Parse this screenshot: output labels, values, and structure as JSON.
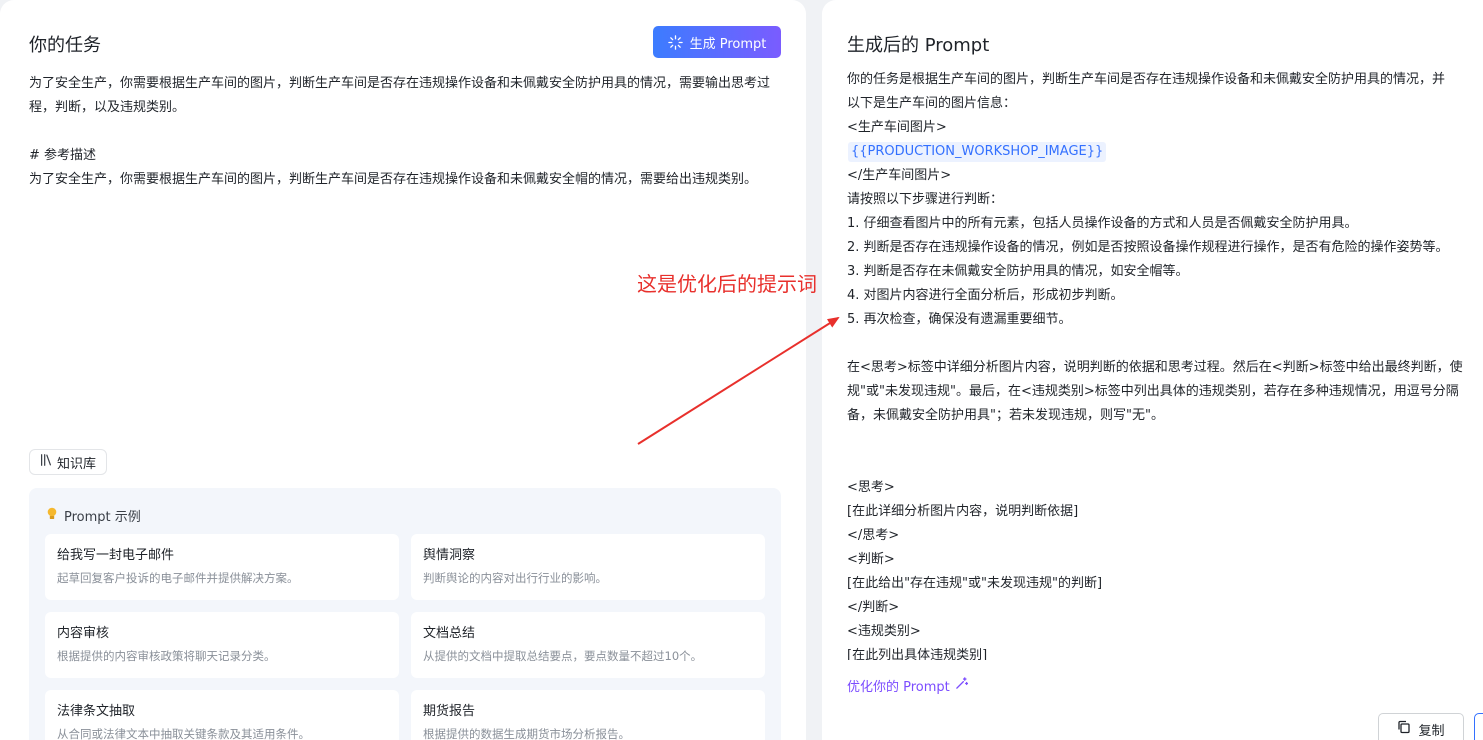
{
  "left": {
    "title": "你的任务",
    "generate_button": "生成 Prompt",
    "task_text": "为了安全生产，你需要根据生产车间的图片，判断生产车间是否存在违规操作设备和未佩戴安全防护用具的情况，需要输出思考过程，判断，以及违规类别。\n\n# 参考描述\n为了安全生产，你需要根据生产车间的图片，判断生产车间是否存在违规操作设备和未佩戴安全帽的情况，需要给出违规类别。",
    "knowledge_chip": "知识库",
    "examples": {
      "header": "Prompt 示例",
      "items": [
        {
          "title": "给我写一封电子邮件",
          "desc": "起草回复客户投诉的电子邮件并提供解决方案。"
        },
        {
          "title": "舆情洞察",
          "desc": "判断舆论的内容对出行行业的影响。"
        },
        {
          "title": "内容审核",
          "desc": "根据提供的内容审核政策将聊天记录分类。"
        },
        {
          "title": "文档总结",
          "desc": "从提供的文档中提取总结要点，要点数量不超过10个。"
        },
        {
          "title": "法律条文抽取",
          "desc": "从合同或法律文本中抽取关键条款及其适用条件。"
        },
        {
          "title": "期货报告",
          "desc": "根据提供的数据生成期货市场分析报告。"
        }
      ]
    }
  },
  "annotation": {
    "text": "这是优化后的提示词",
    "color": "#e8302c"
  },
  "right": {
    "title": "生成后的 Prompt",
    "lines": [
      {
        "text": "你的任务是根据生产车间的图片，判断生产车间是否存在违规操作设备和未佩戴安全防护用具的情况，并"
      },
      {
        "text": "以下是生产车间的图片信息："
      },
      {
        "text": "<生产车间图片>"
      },
      {
        "text": "",
        "token": "{{PRODUCTION_WORKSHOP_IMAGE}}"
      },
      {
        "text": "</生产车间图片>"
      },
      {
        "text": "请按照以下步骤进行判断："
      },
      {
        "text": "1. 仔细查看图片中的所有元素，包括人员操作设备的方式和人员是否佩戴安全防护用具。"
      },
      {
        "text": "2. 判断是否存在违规操作设备的情况，例如是否按照设备操作规程进行操作，是否有危险的操作姿势等。"
      },
      {
        "text": "3. 判断是否存在未佩戴安全防护用具的情况，如安全帽等。"
      },
      {
        "text": "4. 对图片内容进行全面分析后，形成初步判断。"
      },
      {
        "text": "5. 再次检查，确保没有遗漏重要细节。"
      },
      {
        "text": ""
      },
      {
        "text": "在<思考>标签中详细分析图片内容，说明判断的依据和思考过程。然后在<判断>标签中给出最终判断，使"
      },
      {
        "text": "规\"或\"未发现违规\"。最后，在<违规类别>标签中列出具体的违规类别，若存在多种违规情况，用逗号分隔"
      },
      {
        "text": "备，未佩戴安全防护用具\"；若未发现违规，则写\"无\"。"
      },
      {
        "text": ""
      },
      {
        "text": ""
      },
      {
        "text": "<思考>"
      },
      {
        "text": "[在此详细分析图片内容，说明判断依据]"
      },
      {
        "text": "</思考>"
      },
      {
        "text": "<判断>"
      },
      {
        "text": "[在此给出\"存在违规\"或\"未发现违规\"的判断]"
      },
      {
        "text": "</判断>"
      },
      {
        "text": "<违规类别>"
      },
      {
        "text": "[在此列出具体违规类别]"
      },
      {
        "text": "</违规类别>"
      }
    ],
    "optimize_link": "优化你的 Prompt",
    "copy_button": "复制"
  },
  "colors": {
    "accent_blue": "#3370ff",
    "accent_purple": "#7c4dff",
    "annotation_red": "#e8302c"
  },
  "icons": {
    "generate": "sparkle-icon",
    "knowledge": "books-icon",
    "examples": "lightbulb-icon",
    "optimize": "magic-wand-icon",
    "copy": "copy-icon"
  }
}
